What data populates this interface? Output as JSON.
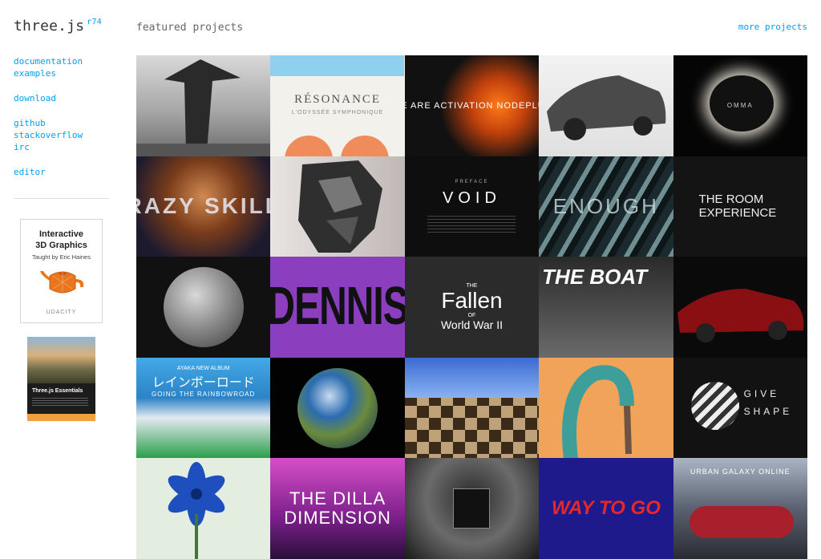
{
  "sidebar": {
    "logo": "three.js",
    "revision": "r74",
    "nav": {
      "documentation": "documentation",
      "examples": "examples",
      "download": "download",
      "github": "github",
      "stackoverflow": "stackoverflow",
      "irc": "irc",
      "editor": "editor"
    },
    "ad_udacity": {
      "title_line1": "Interactive",
      "title_line2": "3D Graphics",
      "taught_by": "Taught by Eric Haines",
      "brand": "UDACITY"
    },
    "ad_book": {
      "title": "Three.js Essentials"
    }
  },
  "header": {
    "title": "featured projects",
    "more_link": "more projects"
  },
  "projects": [
    {
      "caption": ""
    },
    {
      "caption": "RÉSONANCE",
      "sub": "L'ODYSSÉE SYMPHONIQUE"
    },
    {
      "caption": "WE ARE ACTIVATION NODEPLUS"
    },
    {
      "caption": ""
    },
    {
      "caption": "OMMA"
    },
    {
      "caption": "RAZY SKILL"
    },
    {
      "caption": ""
    },
    {
      "caption": "VOID",
      "sub": "PREFACE"
    },
    {
      "caption": "ENOUGH"
    },
    {
      "caption": "THE ROOM",
      "sub": "EXPERIENCE"
    },
    {
      "caption": ""
    },
    {
      "caption": "DENNIS"
    },
    {
      "caption": "Fallen",
      "sub": "World War II",
      "pre": "THE",
      "mid": "OF"
    },
    {
      "caption": "THE BOAT"
    },
    {
      "caption": ""
    },
    {
      "caption": "レインボーロード",
      "sub": "GOING THE RAINBOWROAD",
      "pre": "AYAKA NEW ALBUM"
    },
    {
      "caption": ""
    },
    {
      "caption": ""
    },
    {
      "caption": ""
    },
    {
      "caption": "GIVE",
      "sub": "SHAPE"
    },
    {
      "caption": ""
    },
    {
      "caption": "THE DILLA",
      "sub": "DIMENSION"
    },
    {
      "caption": ""
    },
    {
      "caption": "WAY TO GO"
    },
    {
      "caption": "URBAN GALAXY ONLINE"
    }
  ]
}
